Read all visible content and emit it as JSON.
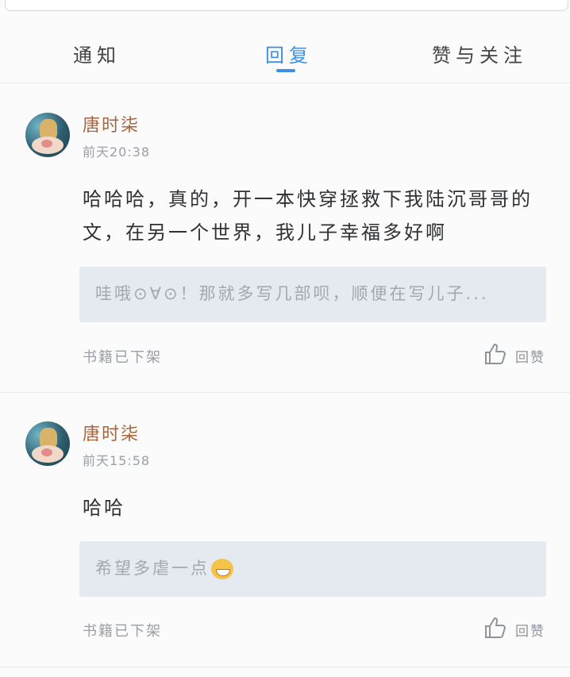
{
  "tabs": [
    {
      "label": "通知",
      "active": false
    },
    {
      "label": "回复",
      "active": true
    },
    {
      "label": "赞与关注",
      "active": false
    }
  ],
  "colors": {
    "accent": "#3d8fe0",
    "username": "#a8653b",
    "quote_bg": "#e5eaf1"
  },
  "replies": [
    {
      "username": "唐时柒",
      "time": "前天20:38",
      "content": "哈哈哈，真的，开一本快穿拯救下我陆沉哥哥的文，在另一个世界，我儿子幸福多好啊",
      "quote": "哇哦⊙∀⊙！那就多写几部呗，顺便在写儿子...",
      "status": "书籍已下架",
      "like_label": "回赞",
      "like_icon": "thumbs-up-icon"
    },
    {
      "username": "唐时柒",
      "time": "前天15:58",
      "content": "哈哈",
      "quote": "希望多虐一点",
      "quote_emoji": "grinning-face-icon",
      "status": "书籍已下架",
      "like_label": "回赞",
      "like_icon": "thumbs-up-icon"
    }
  ]
}
